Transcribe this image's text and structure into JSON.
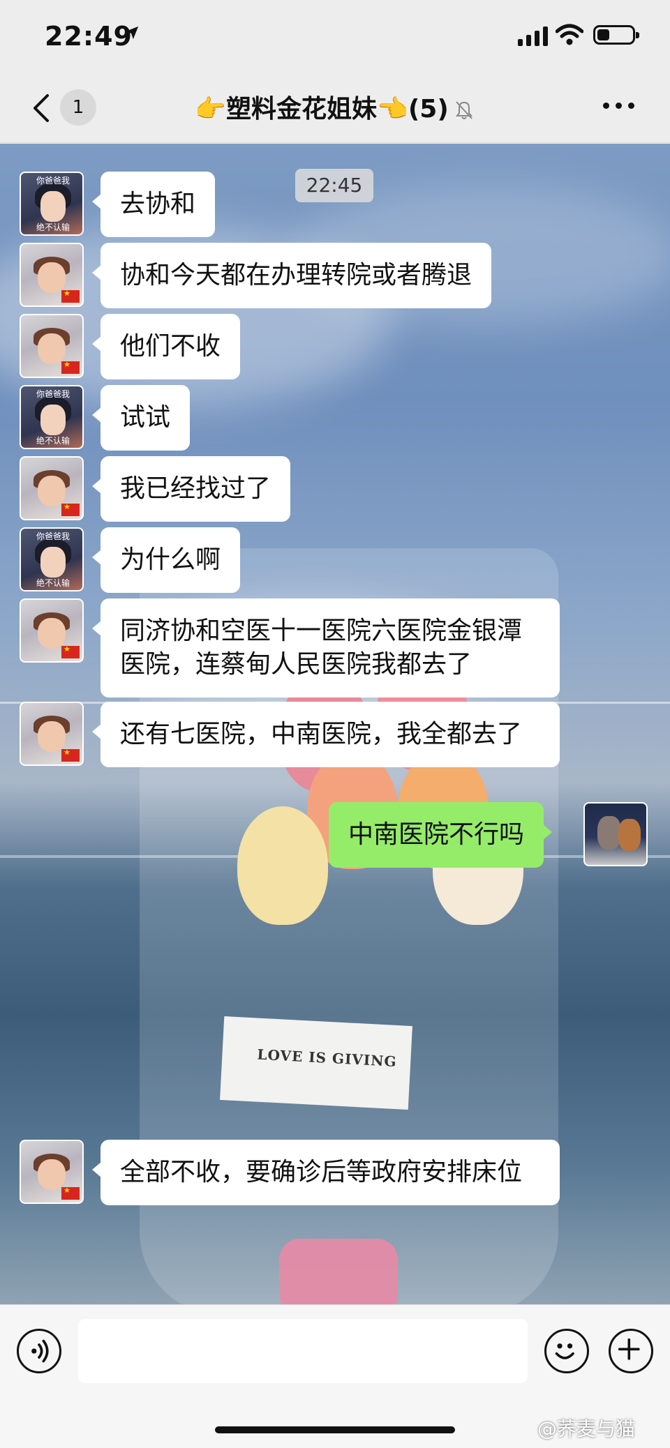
{
  "status_bar": {
    "time": "22:49",
    "battery_level": 0.35,
    "signal_bars": 4
  },
  "nav": {
    "back_badge": "1",
    "title": "👉塑料金花姐妹👈(5)",
    "muted_icon": "bell-muted-icon",
    "more_icon": "more-dots-icon"
  },
  "chat": {
    "timestamp": "22:45",
    "messages": [
      {
        "sender": "avatar-girl",
        "text": "去协和"
      },
      {
        "sender": "avatar-baby",
        "text": "协和今天都在办理转院或者腾退"
      },
      {
        "sender": "avatar-baby",
        "text": "他们不收"
      },
      {
        "sender": "avatar-girl",
        "text": "试试"
      },
      {
        "sender": "avatar-baby",
        "text": "我已经找过了"
      },
      {
        "sender": "avatar-girl",
        "text": "为什么啊"
      },
      {
        "sender": "avatar-baby",
        "text": "同济协和空医十一医院六医院金银潭医院，连蔡甸人民医院我都去了"
      },
      {
        "sender": "avatar-baby",
        "text": "还有七医院，中南医院，我全都去了"
      },
      {
        "sender": "me",
        "text": "中南医院不行吗"
      },
      {
        "sender": "avatar-baby",
        "text": "全部不收，要确诊后等政府安排床位"
      }
    ],
    "avatar_captions": {
      "top": "你爸爸我",
      "bottom": "绝不认输"
    },
    "background_card_text": "LOVE IS GIVING"
  },
  "input_bar": {
    "voice_icon": "voice-icon",
    "emoji_icon": "emoji-icon",
    "plus_icon": "plus-icon",
    "watermark": "@荞麦与猫"
  },
  "colors": {
    "my_bubble": "#95ec69",
    "their_bubble": "#ffffff",
    "nav_bg": "#ededed"
  }
}
